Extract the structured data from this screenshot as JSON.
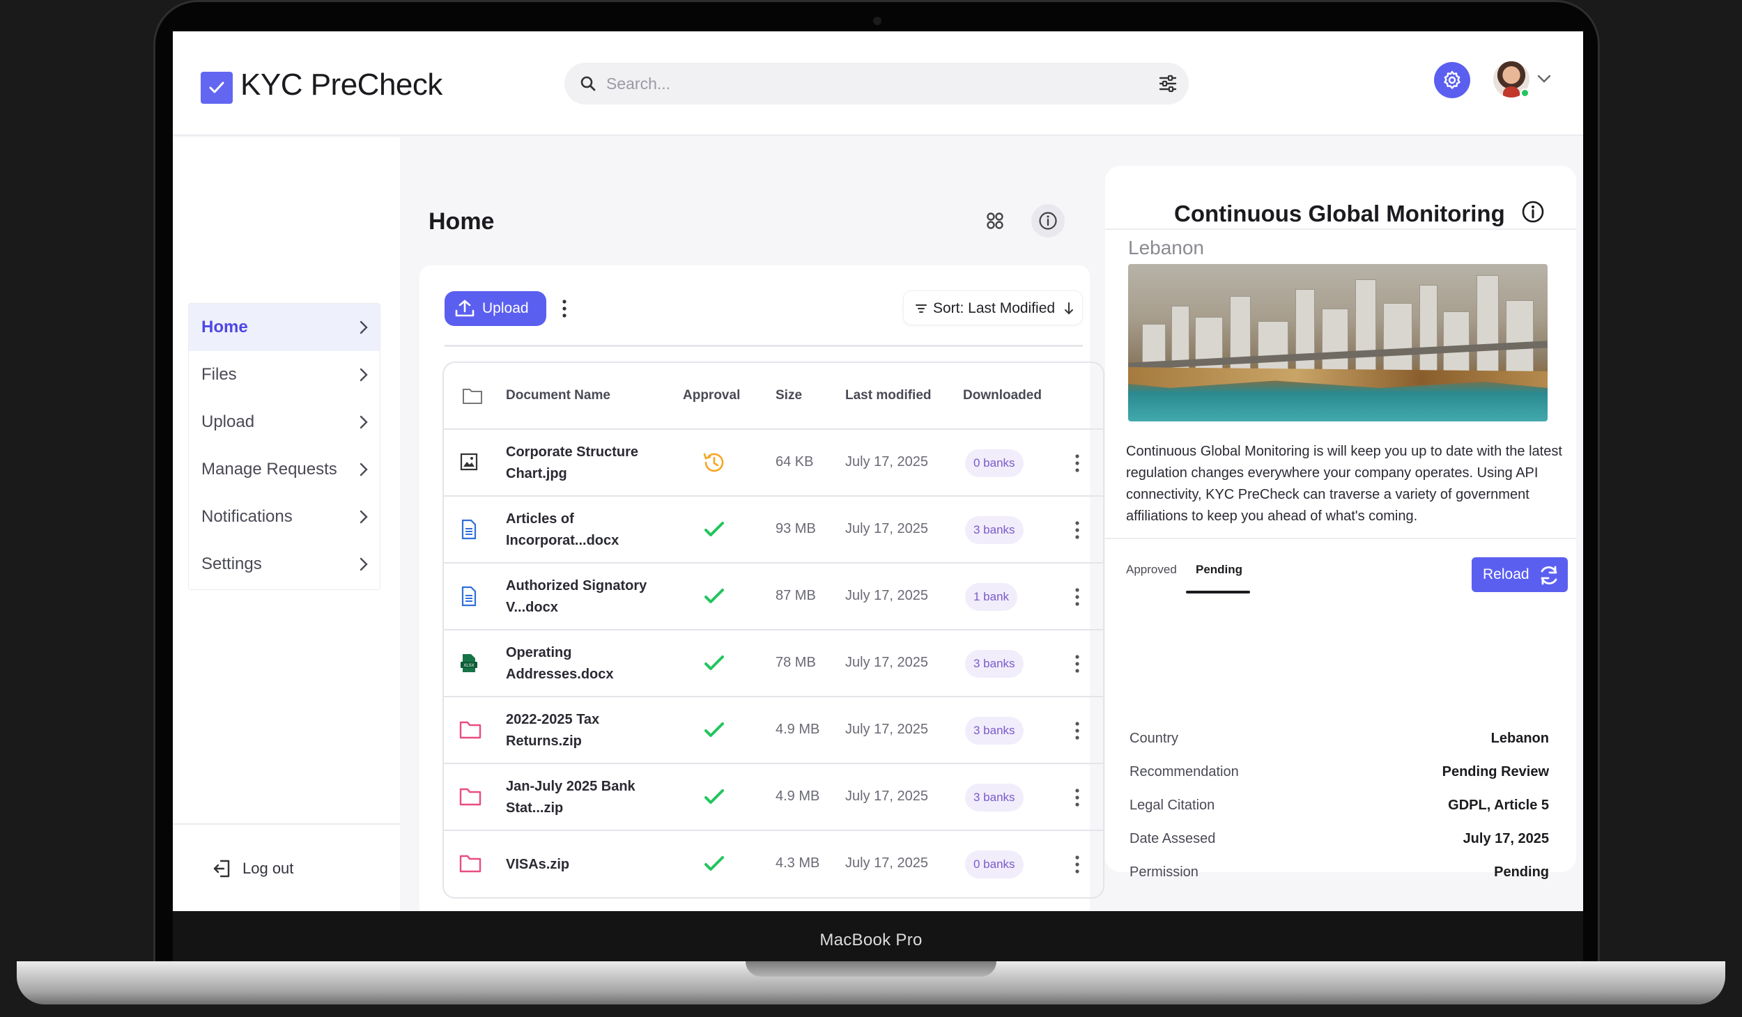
{
  "device": {
    "label": "MacBook Pro"
  },
  "app": {
    "title": "KYC PreCheck"
  },
  "search": {
    "placeholder": "Search..."
  },
  "sidebar": {
    "items": [
      {
        "label": "Home",
        "active": true
      },
      {
        "label": "Files"
      },
      {
        "label": "Upload"
      },
      {
        "label": "Manage Requests"
      },
      {
        "label": "Notifications"
      },
      {
        "label": "Settings"
      }
    ],
    "logout_label": "Log out"
  },
  "main": {
    "title": "Home",
    "upload_label": "Upload",
    "sort_label": "Sort: Last Modified",
    "table": {
      "headers": {
        "name": "Document Name",
        "approval": "Approval",
        "size": "Size",
        "modified": "Last modified",
        "downloaded": "Downloaded"
      },
      "rows": [
        {
          "name": "Corporate Structure Chart.jpg",
          "type": "image-icon",
          "approval": "pending",
          "size": "64 KB",
          "modified": "July 17, 2025",
          "downloaded": "0 banks"
        },
        {
          "name": "Articles of Incorporat...docx",
          "type": "doc-icon",
          "approval": "approved",
          "size": "93 MB",
          "modified": "July 17, 2025",
          "downloaded": "3 banks"
        },
        {
          "name": "Authorized Signatory V...docx",
          "type": "doc-icon",
          "approval": "approved",
          "size": "87 MB",
          "modified": "July 17, 2025",
          "downloaded": "1 bank"
        },
        {
          "name": "Operating Addresses.docx",
          "type": "xlsx-icon",
          "approval": "approved",
          "size": "78 MB",
          "modified": "July 17, 2025",
          "downloaded": "3 banks"
        },
        {
          "name": "2022-2025 Tax Returns.zip",
          "type": "folder-icon",
          "approval": "approved",
          "size": "4.9 MB",
          "modified": "July 17, 2025",
          "downloaded": "3 banks"
        },
        {
          "name": "Jan-July 2025 Bank Stat...zip",
          "type": "folder-icon",
          "approval": "approved",
          "size": "4.9 MB",
          "modified": "July 17, 2025",
          "downloaded": "3 banks"
        },
        {
          "name": "VISAs.zip",
          "type": "folder-icon",
          "approval": "approved",
          "size": "4.3 MB",
          "modified": "July 17, 2025",
          "downloaded": "0 banks"
        }
      ]
    }
  },
  "panel": {
    "title": "Continuous Global Monitoring",
    "country_heading": "Lebanon",
    "description": "Continuous Global Monitoring is will keep you up to date with the latest regulation changes everywhere your company operates. Using API connectivity, KYC PreCheck can traverse a variety of government affiliations to keep you ahead of what's coming.",
    "tabs": {
      "approved": "Approved",
      "pending": "Pending"
    },
    "reload_label": "Reload",
    "details": [
      {
        "key": "Country",
        "value": "Lebanon"
      },
      {
        "key": "Recommendation",
        "value": "Pending Review"
      },
      {
        "key": "Legal Citation",
        "value": "GDPL, Article 5"
      },
      {
        "key": "Date Assesed",
        "value": "July 17, 2025"
      },
      {
        "key": "Permission",
        "value": "Pending"
      }
    ]
  },
  "colors": {
    "accent": "#5b5ff0",
    "approved": "#22c55e",
    "pending": "#f5a623",
    "badge_text": "#7a5ac9"
  }
}
